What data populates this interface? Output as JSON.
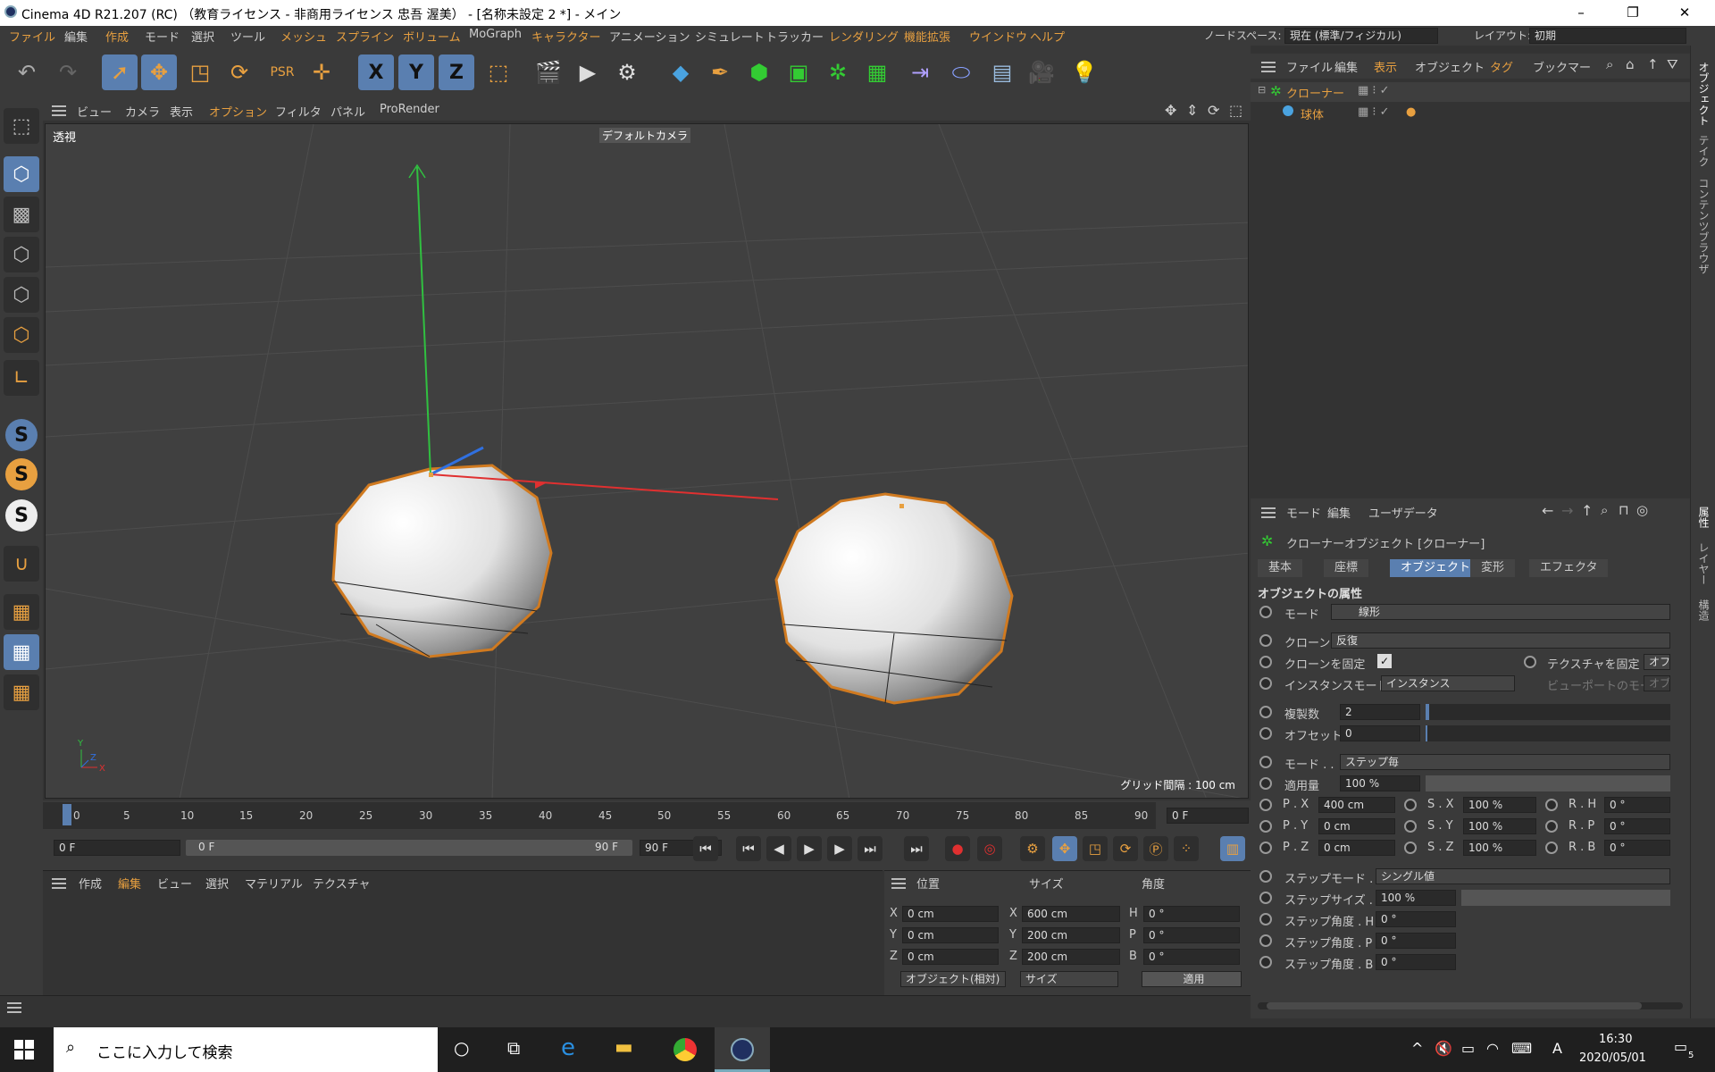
{
  "window": {
    "title": "Cinema 4D R21.207 (RC) （教育ライセンス - 非商用ライセンス 忠吾 渥美） - [名称未設定 2 *] - メイン",
    "minimize": "–",
    "maximize": "❐",
    "close": "✕"
  },
  "menu": {
    "items": [
      "ファイル",
      "編集",
      "作成",
      "モード",
      "選択",
      "ツール",
      "メッシュ",
      "スプライン",
      "ボリューム",
      "MoGraph",
      "キャラクター",
      "アニメーション",
      "シミュレート",
      "トラッカー",
      "レンダリング",
      "機能拡張",
      "ウインドウ",
      "ヘルプ"
    ],
    "nodespace_label": "ノードスペース:",
    "nodespace_value": "現在 (標準/フィジカル)",
    "layout_label": "レイアウト:",
    "layout_value": "初期"
  },
  "toolbar": {
    "undo": "↶",
    "redo": "↷",
    "axis_x": "X",
    "axis_y": "Y",
    "axis_z": "Z"
  },
  "viewport": {
    "menu": [
      "ビュー",
      "カメラ",
      "表示",
      "オプション",
      "フィルタ",
      "パネル",
      "ProRender"
    ],
    "projection": "透視",
    "camera": "デフォルトカメラ",
    "grid_spacing": "グリッド間隔 : 100 cm"
  },
  "timeline": {
    "ticks": [
      "0",
      "5",
      "10",
      "15",
      "20",
      "25",
      "30",
      "35",
      "40",
      "45",
      "50",
      "55",
      "60",
      "65",
      "70",
      "75",
      "80",
      "85",
      "90"
    ],
    "current_frame": "0 F",
    "start_frame": "0 F",
    "range_start": "0 F",
    "range_end": "90 F",
    "end_frame": "90 F"
  },
  "material": {
    "menu": [
      "作成",
      "編集",
      "ビュー",
      "選択",
      "マテリアル",
      "テクスチャ"
    ]
  },
  "coords": {
    "headers": [
      "位置",
      "サイズ",
      "角度"
    ],
    "rows": [
      {
        "axis": "X",
        "pos": "0 cm",
        "saxis": "X",
        "size": "600 cm",
        "raxis": "H",
        "rot": "0 °"
      },
      {
        "axis": "Y",
        "pos": "0 cm",
        "saxis": "Y",
        "size": "200 cm",
        "raxis": "P",
        "rot": "0 °"
      },
      {
        "axis": "Z",
        "pos": "0 cm",
        "saxis": "Z",
        "size": "200 cm",
        "raxis": "B",
        "rot": "0 °"
      }
    ],
    "mode": "オブジェクト(相対)",
    "size_mode": "サイズ",
    "apply": "適用"
  },
  "objects": {
    "menu": [
      "ファイル",
      "編集",
      "表示",
      "オブジェクト",
      "タグ",
      "ブックマー"
    ],
    "tree": [
      {
        "name": "クローナー"
      },
      {
        "name": "球体"
      }
    ]
  },
  "attributes": {
    "menu": [
      "モード",
      "編集",
      "ユーザデータ"
    ],
    "object_title": "クローナーオブジェクト [クローナー]",
    "tabs": [
      "基本",
      "座標",
      "オブジェクト",
      "変形",
      "エフェクタ"
    ],
    "section": "オブジェクトの属性",
    "mode_label": "モード",
    "mode_value": "線形",
    "clone_label": "クローン",
    "clone_value": "反復",
    "fix_clone_label": "クローンを固定",
    "fix_texture_label": "テクスチャを固定 . .",
    "fix_texture_value": "オフ",
    "instance_label": "インスタンスモード",
    "instance_value": "インスタンス",
    "viewport_mode_label": "ビューポートのモード",
    "viewport_mode_value": "オブジ",
    "count_label": "複製数",
    "count_value": "2",
    "offset_label": "オフセット",
    "offset_value": "0",
    "mode2_label": "モード . .",
    "mode2_value": "ステップ毎",
    "amount_label": "適用量",
    "amount_value": "100 %",
    "transform": [
      {
        "p": "P . X",
        "pv": "400 cm",
        "s": "S . X",
        "sv": "100 %",
        "r": "R . H",
        "rv": "0 °"
      },
      {
        "p": "P . Y",
        "pv": "0 cm",
        "s": "S . Y",
        "sv": "100 %",
        "r": "R . P",
        "rv": "0 °"
      },
      {
        "p": "P . Z",
        "pv": "0 cm",
        "s": "S . Z",
        "sv": "100 %",
        "r": "R . B",
        "rv": "0 °"
      }
    ],
    "stepmode_label": "ステップモード . .",
    "stepmode_value": "シングル値",
    "stepsize_label": "ステップサイズ . .",
    "stepsize_value": "100 %",
    "stepangle": [
      {
        "label": "ステップ角度 . H",
        "value": "0 °"
      },
      {
        "label": "ステップ角度 . P",
        "value": "0 °"
      },
      {
        "label": "ステップ角度 . B",
        "value": "0 °"
      }
    ]
  },
  "right_strip": [
    "オブジェクト",
    "テイク",
    "コンテンツブラウザ",
    "属性",
    "レイヤー",
    "構造"
  ],
  "taskbar": {
    "search_placeholder": "ここに入力して検索",
    "time": "16:30",
    "date": "2020/05/01",
    "notifications": "5",
    "ime": "A"
  },
  "colors": {
    "accent": "#e8a040",
    "selection": "#5a7fb0",
    "x_axis": "#e03030",
    "y_axis": "#30c040",
    "z_axis": "#3070e0"
  }
}
